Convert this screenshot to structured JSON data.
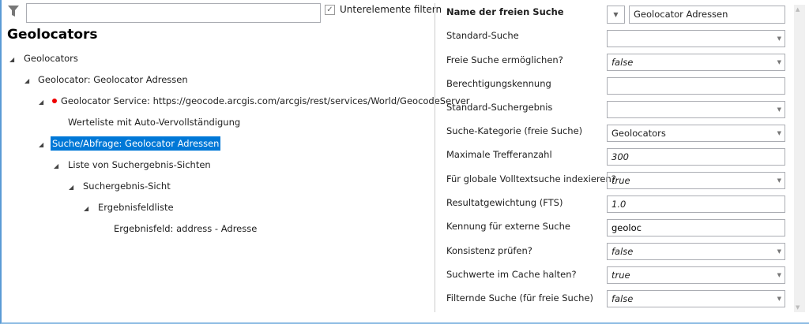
{
  "toolbar": {
    "search_value": "",
    "filter_children_label": "Unterelemente filtern",
    "filter_children_checked": true
  },
  "left": {
    "title": "Geolocators",
    "tree": [
      {
        "label": "Geolocators",
        "expanded": true
      },
      {
        "label": "Geolocator: Geolocator Adressen",
        "expanded": true
      },
      {
        "label": "Geolocator Service: https://geocode.arcgis.com/arcgis/rest/services/World/GeocodeServer",
        "expanded": true,
        "error": true
      },
      {
        "label": "Werteliste mit Auto-Vervollständigung"
      },
      {
        "label": "Suche/Abfrage: Geolocator Adressen",
        "expanded": true,
        "selected": true
      },
      {
        "label": "Liste von Suchergebnis-Sichten",
        "expanded": true
      },
      {
        "label": "Suchergebnis-Sicht",
        "expanded": true
      },
      {
        "label": "Ergebnisfeldliste",
        "expanded": true
      },
      {
        "label": "Ergebnisfeld: address - Adresse"
      }
    ]
  },
  "props": [
    {
      "label": "Name der freien Suche",
      "value": "Geolocator Adressen"
    },
    {
      "label": "Standard-Suche",
      "value": ""
    },
    {
      "label": "Freie Suche ermöglichen?",
      "value": "false"
    },
    {
      "label": "Berechtigungskennung",
      "value": ""
    },
    {
      "label": "Standard-Suchergebnis",
      "value": ""
    },
    {
      "label": "Suche-Kategorie (freie Suche)",
      "value": "Geolocators"
    },
    {
      "label": "Maximale Trefferanzahl",
      "value": "300"
    },
    {
      "label": "Für globale Volltextsuche indexieren?",
      "value": "true"
    },
    {
      "label": "Resultatgewichtung (FTS)",
      "value": "1.0"
    },
    {
      "label": "Kennung für externe Suche",
      "value": "geoloc"
    },
    {
      "label": "Konsistenz prüfen?",
      "value": "false"
    },
    {
      "label": "Suchwerte im Cache halten?",
      "value": "true"
    },
    {
      "label": "Filternde Suche (für freie Suche)",
      "value": "false"
    }
  ]
}
